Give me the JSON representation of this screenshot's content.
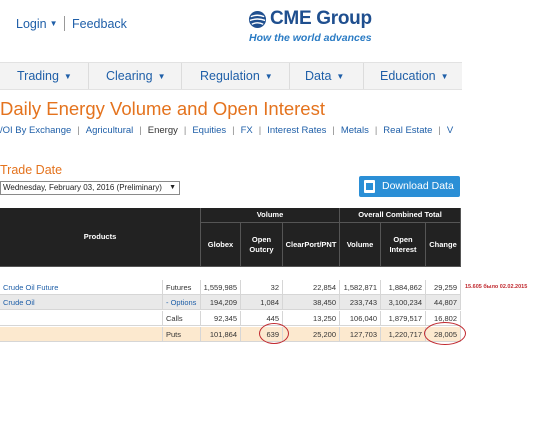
{
  "header": {
    "login_label": "Login",
    "feedback_label": "Feedback",
    "logo_name": "CME Group",
    "logo_tagline": "How the world advances"
  },
  "nav": {
    "items": [
      {
        "label": "Trading"
      },
      {
        "label": "Clearing"
      },
      {
        "label": "Regulation"
      },
      {
        "label": "Data"
      },
      {
        "label": "Education"
      }
    ]
  },
  "page": {
    "title": "Daily Energy Volume and Open Interest",
    "subnav": [
      {
        "label": "/OI By Exchange"
      },
      {
        "label": "Agricultural"
      },
      {
        "label": "Energy"
      },
      {
        "label": "Equities"
      },
      {
        "label": "FX"
      },
      {
        "label": "Interest Rates"
      },
      {
        "label": "Metals"
      },
      {
        "label": "Real Estate"
      },
      {
        "label": "V"
      }
    ],
    "trade_date_label": "Trade Date",
    "trade_date_value": "Wednesday, February 03, 2016 (Preliminary)",
    "download_label": "Download Data"
  },
  "table": {
    "products_header": "Products",
    "volume_header": "Volume",
    "total_header": "Overall Combined Total",
    "columns": [
      "Globex",
      "Open Outcry",
      "ClearPort/PNT",
      "Volume",
      "Open Interest",
      "Change"
    ],
    "rows": [
      {
        "product": "Crude Oil Future",
        "type": "Futures",
        "globex": "1,559,985",
        "outcry": "32",
        "clearport": "22,854",
        "volume": "1,582,871",
        "oi": "1,884,862",
        "change": "29,259"
      },
      {
        "product": "Crude Oil",
        "type": "- Options",
        "globex": "194,209",
        "outcry": "1,084",
        "clearport": "38,450",
        "volume": "233,743",
        "oi": "3,100,234",
        "change": "44,807"
      },
      {
        "product": "",
        "type": "Calls",
        "globex": "92,345",
        "outcry": "445",
        "clearport": "13,250",
        "volume": "106,040",
        "oi": "1,879,517",
        "change": "16,802"
      },
      {
        "product": "",
        "type": "Puts",
        "globex": "101,864",
        "outcry": "639",
        "clearport": "25,200",
        "volume": "127,703",
        "oi": "1,220,717",
        "change": "28,005"
      }
    ],
    "annotation": "15.605 было 02.02.2015"
  },
  "colors": {
    "accent_orange": "#e4731e",
    "link_blue": "#1f5fa8",
    "button_blue": "#2b8fd6",
    "header_dark": "#222222",
    "puts_highlight": "#fce9cf",
    "annotation_red": "#c0282e"
  }
}
